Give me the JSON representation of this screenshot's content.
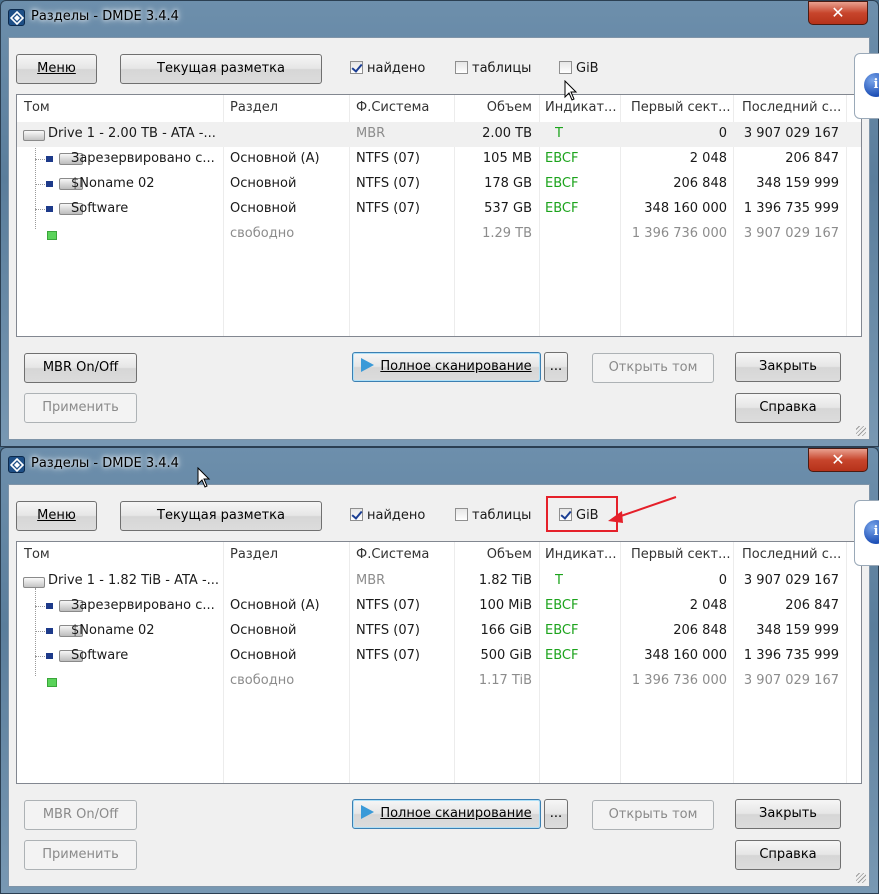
{
  "windows": [
    {
      "title": "Разделы - DMDE 3.4.4",
      "close_label": "✕",
      "buttons": {
        "menu": "Меню",
        "current_layout": "Текущая разметка",
        "mbr": "MBR On/Off",
        "full_scan": "Полное сканирование",
        "more": "...",
        "open_volume": "Открыть том",
        "close": "Закрыть",
        "apply": "Применить",
        "help": "Справка"
      },
      "checkboxes": {
        "found": {
          "label": "найдено",
          "checked": true
        },
        "tables": {
          "label": "таблицы",
          "checked": false
        },
        "gib": {
          "label": "GiB",
          "checked": false
        }
      },
      "columns": [
        "Том",
        "Раздел",
        "Ф.Система",
        "Объем",
        "Индикат...",
        "Первый сект...",
        "Последний с..."
      ],
      "rows": [
        {
          "volume": "Drive 1 - 2.00 TB - ATA -...",
          "partition": "",
          "fs": "MBR",
          "size": "2.00 TB",
          "indicator": "T",
          "first": "0",
          "last": "3 907 029 167"
        },
        {
          "volume": "Зарезервировано с...",
          "partition": "Основной (A)",
          "fs": "NTFS (07)",
          "size": "105 MB",
          "indicator": "EBCF",
          "first": "2 048",
          "last": "206 847"
        },
        {
          "volume": "$Noname 02",
          "partition": "Основной",
          "fs": "NTFS (07)",
          "size": "178 GB",
          "indicator": "EBCF",
          "first": "206 848",
          "last": "348 159 999"
        },
        {
          "volume": "Software",
          "partition": "Основной",
          "fs": "NTFS (07)",
          "size": "537 GB",
          "indicator": "EBCF",
          "first": "348 160 000",
          "last": "1 396 735 999"
        },
        {
          "volume": "",
          "partition": "свободно",
          "fs": "",
          "size": "1.29 TB",
          "indicator": "",
          "first": "1 396 736 000",
          "last": "3 907 029 167"
        }
      ]
    },
    {
      "title": "Разделы - DMDE 3.4.4",
      "close_label": "✕",
      "buttons": {
        "menu": "Меню",
        "current_layout": "Текущая разметка",
        "mbr": "MBR On/Off",
        "full_scan": "Полное сканирование",
        "more": "...",
        "open_volume": "Открыть том",
        "close": "Закрыть",
        "apply": "Применить",
        "help": "Справка"
      },
      "checkboxes": {
        "found": {
          "label": "найдено",
          "checked": true
        },
        "tables": {
          "label": "таблицы",
          "checked": false
        },
        "gib": {
          "label": "GiB",
          "checked": true
        }
      },
      "columns": [
        "Том",
        "Раздел",
        "Ф.Система",
        "Объем",
        "Индикат...",
        "Первый сект...",
        "Последний с..."
      ],
      "rows": [
        {
          "volume": "Drive 1 - 1.82 TiB - ATA -...",
          "partition": "",
          "fs": "MBR",
          "size": "1.82 TiB",
          "indicator": "T",
          "first": "0",
          "last": "3 907 029 167"
        },
        {
          "volume": "Зарезервировано с...",
          "partition": "Основной (A)",
          "fs": "NTFS (07)",
          "size": "100 MiB",
          "indicator": "EBCF",
          "first": "2 048",
          "last": "206 847"
        },
        {
          "volume": "$Noname 02",
          "partition": "Основной",
          "fs": "NTFS (07)",
          "size": "166 GiB",
          "indicator": "EBCF",
          "first": "206 848",
          "last": "348 159 999"
        },
        {
          "volume": "Software",
          "partition": "Основной",
          "fs": "NTFS (07)",
          "size": "500 GiB",
          "indicator": "EBCF",
          "first": "348 160 000",
          "last": "1 396 735 999"
        },
        {
          "volume": "",
          "partition": "свободно",
          "fs": "",
          "size": "1.17 TiB",
          "indicator": "",
          "first": "1 396 736 000",
          "last": "3 907 029 167"
        }
      ]
    }
  ],
  "colors": {
    "highlight": "#e5202a",
    "indicator_green": "#1ca31c",
    "muted_gray": "#8c8c8c"
  }
}
